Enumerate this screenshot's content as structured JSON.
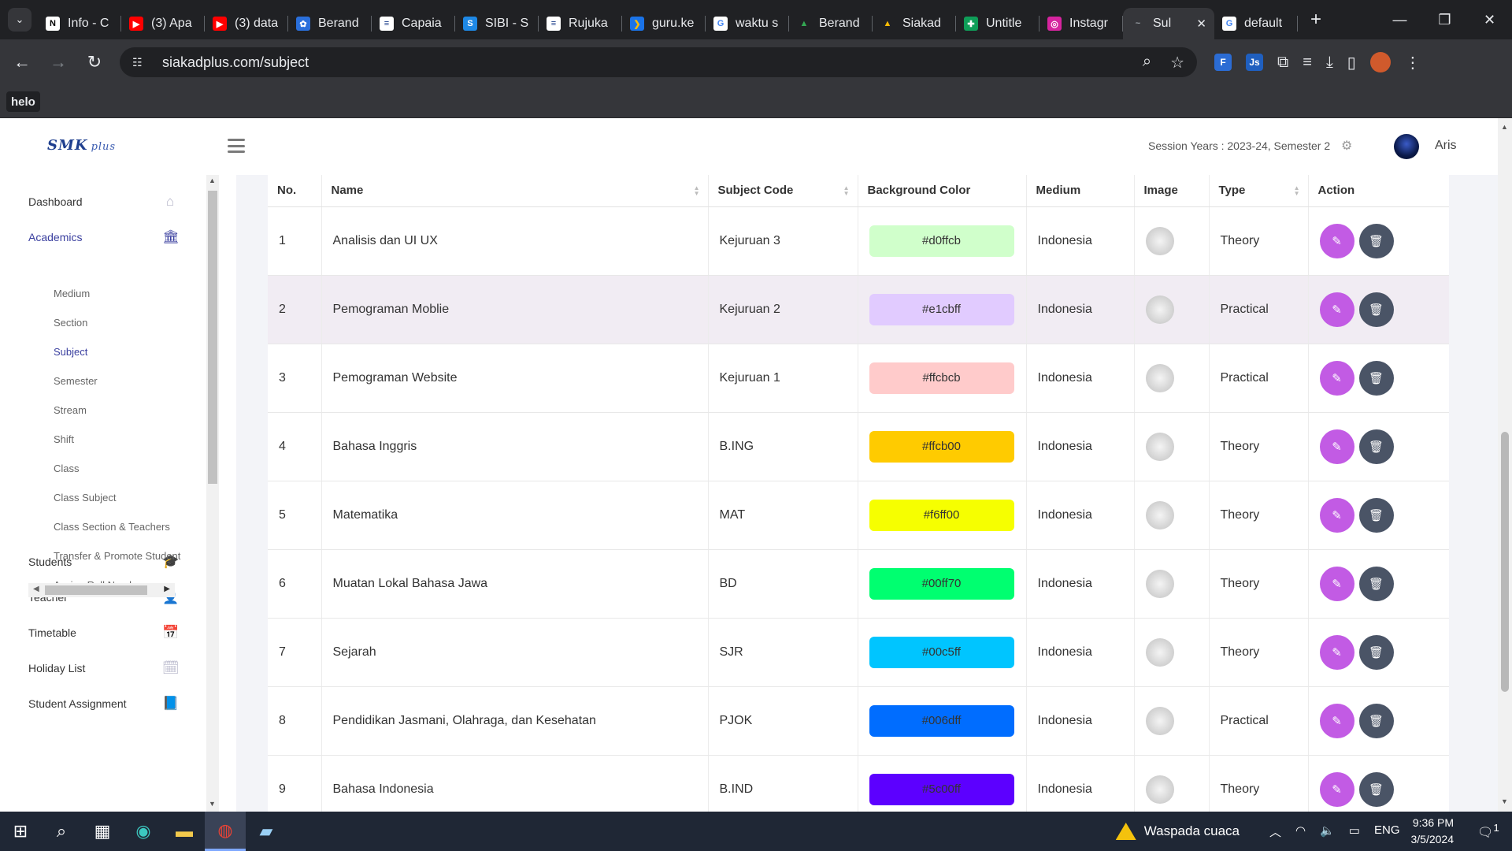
{
  "browser": {
    "tabs": [
      {
        "title": "Info - C",
        "favicon_text": "N",
        "favicon_color": "#ffffff",
        "favicon_fg": "#000000"
      },
      {
        "title": "(3) Apa",
        "favicon_text": "▶",
        "favicon_color": "#ff0000",
        "favicon_fg": "#ffffff"
      },
      {
        "title": "(3) data",
        "favicon_text": "▶",
        "favicon_color": "#ff0000",
        "favicon_fg": "#ffffff"
      },
      {
        "title": "Berand",
        "favicon_text": "✿",
        "favicon_color": "#2a6fdb",
        "favicon_fg": "#ffffff"
      },
      {
        "title": "Capaia",
        "favicon_text": "≡",
        "favicon_color": "#ffffff",
        "favicon_fg": "#1a3c8a"
      },
      {
        "title": "SIBI - S",
        "favicon_text": "S",
        "favicon_color": "#1e88e5",
        "favicon_fg": "#ffffff"
      },
      {
        "title": "Rujuka",
        "favicon_text": "≡",
        "favicon_color": "#ffffff",
        "favicon_fg": "#1a3c8a"
      },
      {
        "title": "guru.ke",
        "favicon_text": "❯",
        "favicon_color": "#1a73e8",
        "favicon_fg": "#fbbc04"
      },
      {
        "title": "waktu s",
        "favicon_text": "G",
        "favicon_color": "#ffffff",
        "favicon_fg": "#4285f4"
      },
      {
        "title": "Berand",
        "favicon_text": "▲",
        "favicon_color": "#202124",
        "favicon_fg": "#34a853"
      },
      {
        "title": "Siakad",
        "favicon_text": "▲",
        "favicon_color": "#202124",
        "favicon_fg": "#fbbc04"
      },
      {
        "title": "Untitle",
        "favicon_text": "✚",
        "favicon_color": "#0f9d58",
        "favicon_fg": "#ffffff"
      },
      {
        "title": "Instagr",
        "favicon_text": "◎",
        "favicon_color": "#d6249f",
        "favicon_fg": "#ffffff"
      },
      {
        "title": "Sul",
        "favicon_text": "~",
        "favicon_color": "#35363a",
        "favicon_fg": "#9aa0a6",
        "active": true
      },
      {
        "title": "default",
        "favicon_text": "G",
        "favicon_color": "#ffffff",
        "favicon_fg": "#4285f4"
      }
    ],
    "url": "siakadplus.com/subject",
    "bookmark": "helo",
    "extensions": [
      {
        "text": "F",
        "color": "#2b6cd4"
      },
      {
        "text": "Js",
        "color": "#1f5fbf"
      }
    ]
  },
  "header": {
    "logo": "SMK",
    "session": "Session Years : 2023-24, Semester 2",
    "username": "Aris"
  },
  "sidebar": {
    "menu": [
      {
        "label": "Dashboard",
        "icon": "home-icon",
        "glyph": "⌂"
      },
      {
        "label": "Academics",
        "icon": "bank-icon",
        "glyph": "🏛",
        "active": true
      },
      {
        "label": "Students",
        "icon": "graduation-cap-icon",
        "glyph": "🎓"
      },
      {
        "label": "Teacher",
        "icon": "user-icon",
        "glyph": "👤"
      },
      {
        "label": "Timetable",
        "icon": "calendar-icon",
        "glyph": "📅"
      },
      {
        "label": "Holiday List",
        "icon": "calendar-check-icon",
        "glyph": "🗓"
      },
      {
        "label": "Student Assignment",
        "icon": "book-icon",
        "glyph": "📘"
      }
    ],
    "submenu": [
      {
        "label": "Medium"
      },
      {
        "label": "Section"
      },
      {
        "label": "Subject",
        "active": true
      },
      {
        "label": "Semester"
      },
      {
        "label": "Stream"
      },
      {
        "label": "Shift"
      },
      {
        "label": "Class"
      },
      {
        "label": "Class Subject"
      },
      {
        "label": "Class Section & Teachers"
      },
      {
        "label": "Transfer & Promote Student"
      },
      {
        "label": "Assign Roll Number"
      }
    ]
  },
  "table": {
    "columns": [
      "No.",
      "Name",
      "Subject Code",
      "Background Color",
      "Medium",
      "Image",
      "Type",
      "Action"
    ],
    "rows": [
      {
        "no": "1",
        "name": "Analisis dan UI UX",
        "code": "Kejuruan 3",
        "color": "#d0ffcb",
        "medium": "Indonesia",
        "type": "Theory"
      },
      {
        "no": "2",
        "name": "Pemograman Moblie",
        "code": "Kejuruan 2",
        "color": "#e1cbff",
        "medium": "Indonesia",
        "type": "Practical",
        "highlight": true
      },
      {
        "no": "3",
        "name": "Pemograman Website",
        "code": "Kejuruan 1",
        "color": "#ffcbcb",
        "medium": "Indonesia",
        "type": "Practical"
      },
      {
        "no": "4",
        "name": "Bahasa Inggris",
        "code": "B.ING",
        "color": "#ffcb00",
        "medium": "Indonesia",
        "type": "Theory"
      },
      {
        "no": "5",
        "name": "Matematika",
        "code": "MAT",
        "color": "#f6ff00",
        "medium": "Indonesia",
        "type": "Theory"
      },
      {
        "no": "6",
        "name": "Muatan Lokal Bahasa Jawa",
        "code": "BD",
        "color": "#00ff70",
        "medium": "Indonesia",
        "type": "Theory"
      },
      {
        "no": "7",
        "name": "Sejarah",
        "code": "SJR",
        "color": "#00c5ff",
        "medium": "Indonesia",
        "type": "Theory"
      },
      {
        "no": "8",
        "name": "Pendidikan Jasmani, Olahraga, dan Kesehatan",
        "code": "PJOK",
        "color": "#006dff",
        "medium": "Indonesia",
        "type": "Practical"
      },
      {
        "no": "9",
        "name": "Bahasa Indonesia",
        "code": "B.IND",
        "color": "#5c00ff",
        "medium": "Indonesia",
        "type": "Theory"
      }
    ]
  },
  "taskbar": {
    "weather": "Waspada cuaca",
    "language": "ENG",
    "time": "9:36 PM",
    "date": "3/5/2024",
    "notifications": "1"
  }
}
